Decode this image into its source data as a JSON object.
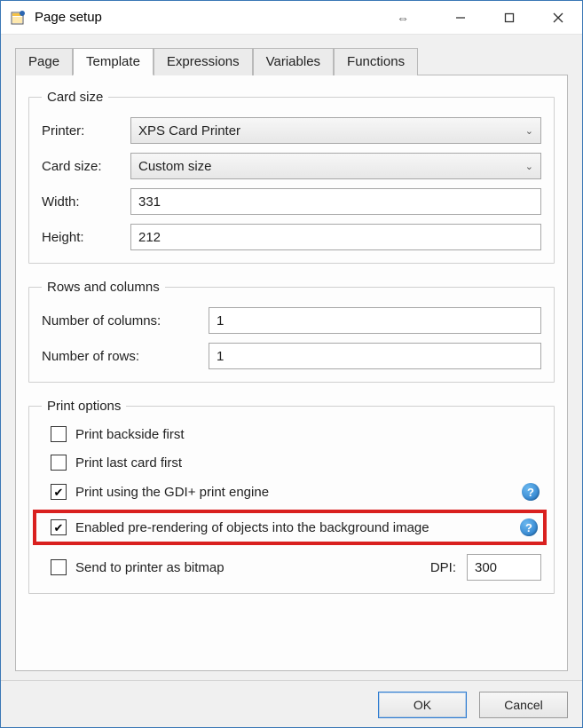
{
  "window": {
    "title": "Page setup"
  },
  "tabs": [
    {
      "label": "Page"
    },
    {
      "label": "Template"
    },
    {
      "label": "Expressions"
    },
    {
      "label": "Variables"
    },
    {
      "label": "Functions"
    }
  ],
  "active_tab_index": 1,
  "card_size": {
    "legend": "Card size",
    "printer_label": "Printer:",
    "printer_value": "XPS Card Printer",
    "cardsize_label": "Card size:",
    "cardsize_value": "Custom size",
    "width_label": "Width:",
    "width_value": "331",
    "height_label": "Height:",
    "height_value": "212"
  },
  "rows_cols": {
    "legend": "Rows and columns",
    "cols_label": "Number of columns:",
    "cols_value": "1",
    "rows_label": "Number of rows:",
    "rows_value": "1"
  },
  "print_options": {
    "legend": "Print options",
    "backside_label": "Print backside first",
    "backside_checked": false,
    "lastcard_label": "Print last card first",
    "lastcard_checked": false,
    "gdi_label": "Print using the GDI+ print engine",
    "gdi_checked": true,
    "prerender_label": "Enabled pre-rendering of objects into the background image",
    "prerender_checked": true,
    "bitmap_label": "Send to printer as bitmap",
    "bitmap_checked": false,
    "dpi_label": "DPI:",
    "dpi_value": "300"
  },
  "buttons": {
    "ok": "OK",
    "cancel": "Cancel"
  }
}
